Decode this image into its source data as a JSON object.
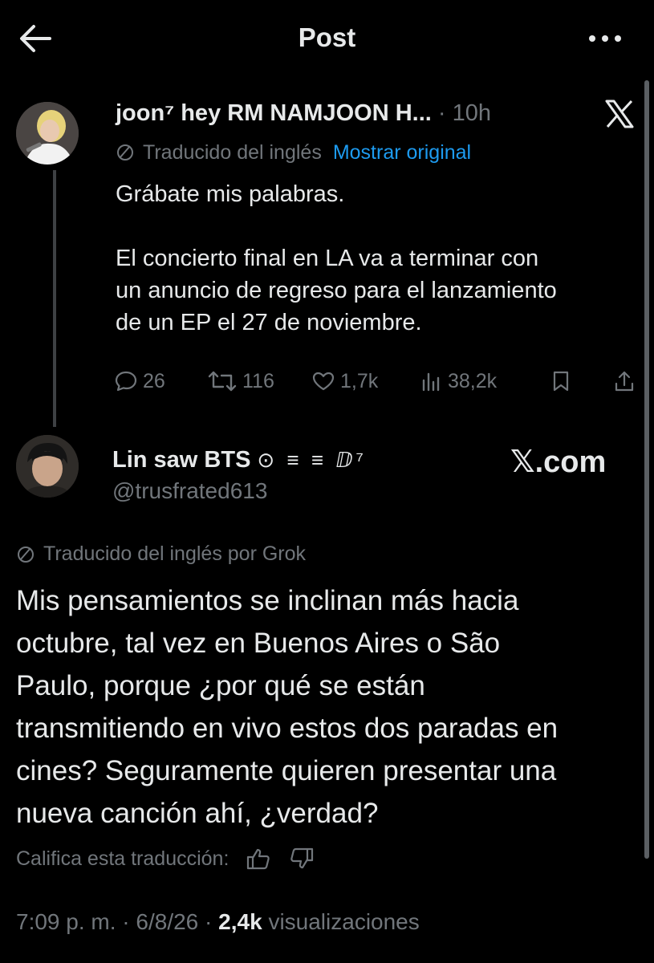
{
  "header": {
    "title": "Post"
  },
  "parent_tweet": {
    "name": "joon⁷ hey RM NAMJOON H...",
    "separator": "·",
    "time": "10h",
    "translation_label": "Traducido del inglés",
    "show_original": "Mostrar original",
    "text_line1": "Grábate mis palabras.",
    "text_line2": "El concierto final en LA va a terminar con\nun anuncio de regreso para el lanzamiento\nde un EP el 27 de noviembre.",
    "stats": {
      "replies": "26",
      "reposts": "116",
      "likes": "1,7k",
      "views": "38,2k"
    }
  },
  "main_tweet": {
    "name": "Lin saw BTS",
    "badges": "⊙ ≡ ≡ ⅅ⁷",
    "handle": "@trusfrated613",
    "watermark": "𝕏.com",
    "translation_label": "Traducido del inglés por Grok",
    "text": "Mis pensamientos se inclinan más hacia\noctubre, tal vez en Buenos Aires o São\nPaulo, porque ¿por qué se están\ntransmitiendo en vivo estos dos paradas en\ncines? Seguramente quieren presentar una\nnueva canción ahí, ¿verdad?",
    "rate_label": "Califica esta traducción:",
    "time": "7:09 p. m.",
    "date": "6/8/26",
    "views_count": "2,4k",
    "views_label": "visualizaciones"
  },
  "colors": {
    "background": "#000000",
    "text": "#e7e9ea",
    "muted": "#71767b",
    "link": "#1d9bf0"
  }
}
